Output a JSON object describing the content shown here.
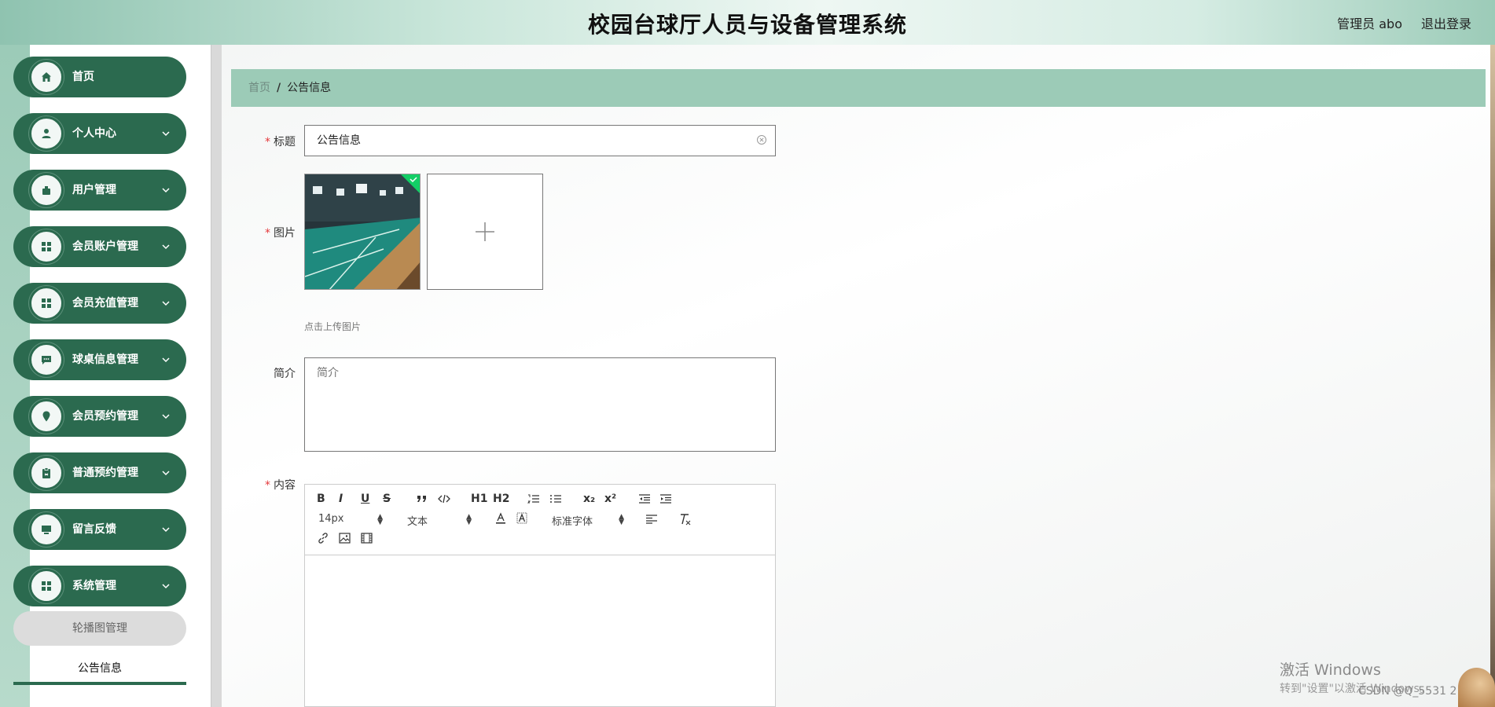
{
  "header": {
    "title": "校园台球厅人员与设备管理系统",
    "user": "管理员 abo",
    "logout": "退出登录"
  },
  "sidebar": {
    "items": [
      {
        "label": "首页",
        "icon": "home-icon"
      },
      {
        "label": "个人中心",
        "icon": "user-icon"
      },
      {
        "label": "用户管理",
        "icon": "user-manage-icon"
      },
      {
        "label": "会员账户管理",
        "icon": "grid-icon"
      },
      {
        "label": "会员充值管理",
        "icon": "grid-icon"
      },
      {
        "label": "球桌信息管理",
        "icon": "chat-icon"
      },
      {
        "label": "会员预约管理",
        "icon": "location-icon"
      },
      {
        "label": "普通预约管理",
        "icon": "clipboard-icon"
      },
      {
        "label": "留言反馈",
        "icon": "monitor-icon"
      },
      {
        "label": "系统管理",
        "icon": "grid-icon"
      }
    ],
    "sub_items": [
      {
        "label": "轮播图管理"
      },
      {
        "label": "公告信息"
      }
    ]
  },
  "breadcrumb": {
    "home": "首页",
    "separator": "/",
    "current": "公告信息"
  },
  "form": {
    "title_label": "标题",
    "title_value": "公告信息",
    "image_label": "图片",
    "upload_tip": "点击上传图片",
    "intro_label": "简介",
    "intro_placeholder": "简介",
    "content_label": "内容"
  },
  "editor": {
    "font_size": "14px",
    "header_select": "文本",
    "font_family": "标准字体",
    "buttons": [
      "B",
      "I",
      "U",
      "S",
      "H1",
      "H2",
      "x₂",
      "x²"
    ]
  },
  "watermark": {
    "line1": "激活 Windows",
    "line2": "转到\"设置\"以激活 Windows。",
    "csdn": "CSDN @Q_5531 2 9 9"
  },
  "colors": {
    "primary": "#2b6a4f",
    "breadcrumb_bg": "#9ccbb7",
    "required": "#e4393c"
  }
}
